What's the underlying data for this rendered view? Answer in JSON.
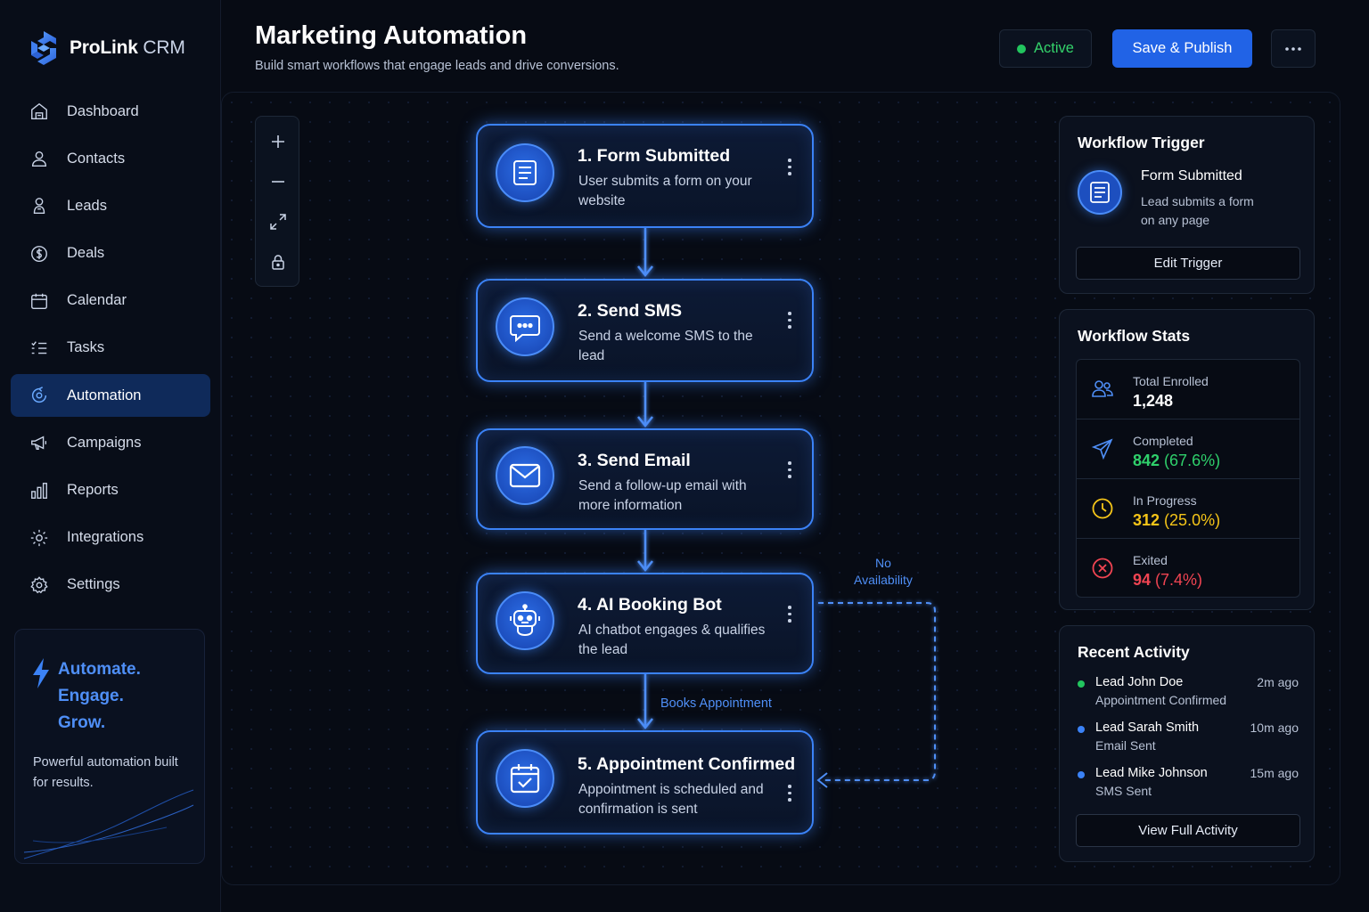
{
  "brand": {
    "name": "ProLink",
    "suffix": " CRM"
  },
  "sidebar": {
    "items": [
      {
        "label": "Dashboard",
        "icon": "home-icon"
      },
      {
        "label": "Contacts",
        "icon": "user-icon"
      },
      {
        "label": "Leads",
        "icon": "lead-icon"
      },
      {
        "label": "Deals",
        "icon": "dollar-icon"
      },
      {
        "label": "Calendar",
        "icon": "calendar-icon"
      },
      {
        "label": "Tasks",
        "icon": "tasks-icon"
      },
      {
        "label": "Automation",
        "icon": "automation-icon",
        "active": true
      },
      {
        "label": "Campaigns",
        "icon": "megaphone-icon"
      },
      {
        "label": "Reports",
        "icon": "bar-chart-icon"
      },
      {
        "label": "Integrations",
        "icon": "puzzle-gear-icon"
      },
      {
        "label": "Settings",
        "icon": "gear-icon"
      }
    ],
    "promo": {
      "line1": "Automate.",
      "line2": "Engage.",
      "line3": "Grow.",
      "text": "Powerful automation built for results."
    }
  },
  "header": {
    "title": "Marketing Automation",
    "subtitle": "Build smart workflows that engage leads and drive conversions.",
    "status": "Active",
    "publish": "Save & Publish"
  },
  "workflow": {
    "nodes": [
      {
        "title": "1.  Form Submitted",
        "desc": "User submits a form on your website",
        "icon": "form-icon"
      },
      {
        "title": "2.  Send SMS",
        "desc": "Send a welcome SMS to the lead",
        "icon": "chat-bubble-icon"
      },
      {
        "title": "3.  Send Email",
        "desc": "Send a follow-up email with more information",
        "icon": "mail-icon"
      },
      {
        "title": "4.  AI Booking Bot",
        "desc": "AI chatbot engages & qualifies the lead",
        "icon": "robot-icon"
      },
      {
        "title": "5.  Appointment Confirmed",
        "desc": "Appointment is scheduled and confirmation is sent",
        "icon": "calendar-check-icon"
      }
    ],
    "branch_yes": "Books Appointment",
    "branch_no_line1": "No",
    "branch_no_line2": "Availability"
  },
  "trigger": {
    "heading": "Workflow Trigger",
    "name": "Form Submitted",
    "desc_line1": "Lead submits a form",
    "desc_line2": "on any page",
    "edit": "Edit Trigger"
  },
  "stats": {
    "heading": "Workflow Stats",
    "rows": [
      {
        "label": "Total Enrolled",
        "value": "1,248",
        "pct": "",
        "color": "#ffffff",
        "icon": "users-icon"
      },
      {
        "label": "Completed",
        "value": "842",
        "pct": " (67.6%)",
        "color": "#2fd06b",
        "icon": "send-icon"
      },
      {
        "label": "In Progress",
        "value": "312",
        "pct": " (25.0%)",
        "color": "#f5c518",
        "icon": "clock-icon"
      },
      {
        "label": "Exited",
        "value": "94",
        "pct": " (7.4%)",
        "color": "#f04452",
        "icon": "x-circle-icon"
      }
    ]
  },
  "activity": {
    "heading": "Recent Activity",
    "items": [
      {
        "title": "Lead John Doe",
        "sub": "Appointment Confirmed",
        "time": "2m ago",
        "color": "#22c55e"
      },
      {
        "title": "Lead Sarah Smith",
        "sub": "Email Sent",
        "time": "10m ago",
        "color": "#3b82f6"
      },
      {
        "title": "Lead Mike Johnson",
        "sub": "SMS Sent",
        "time": "15m ago",
        "color": "#3b82f6"
      }
    ],
    "view_all": "View Full Activity"
  },
  "colors": {
    "accent": "#3b82f6",
    "primary_button": "#2163e6",
    "active_status": "#22c55e"
  }
}
